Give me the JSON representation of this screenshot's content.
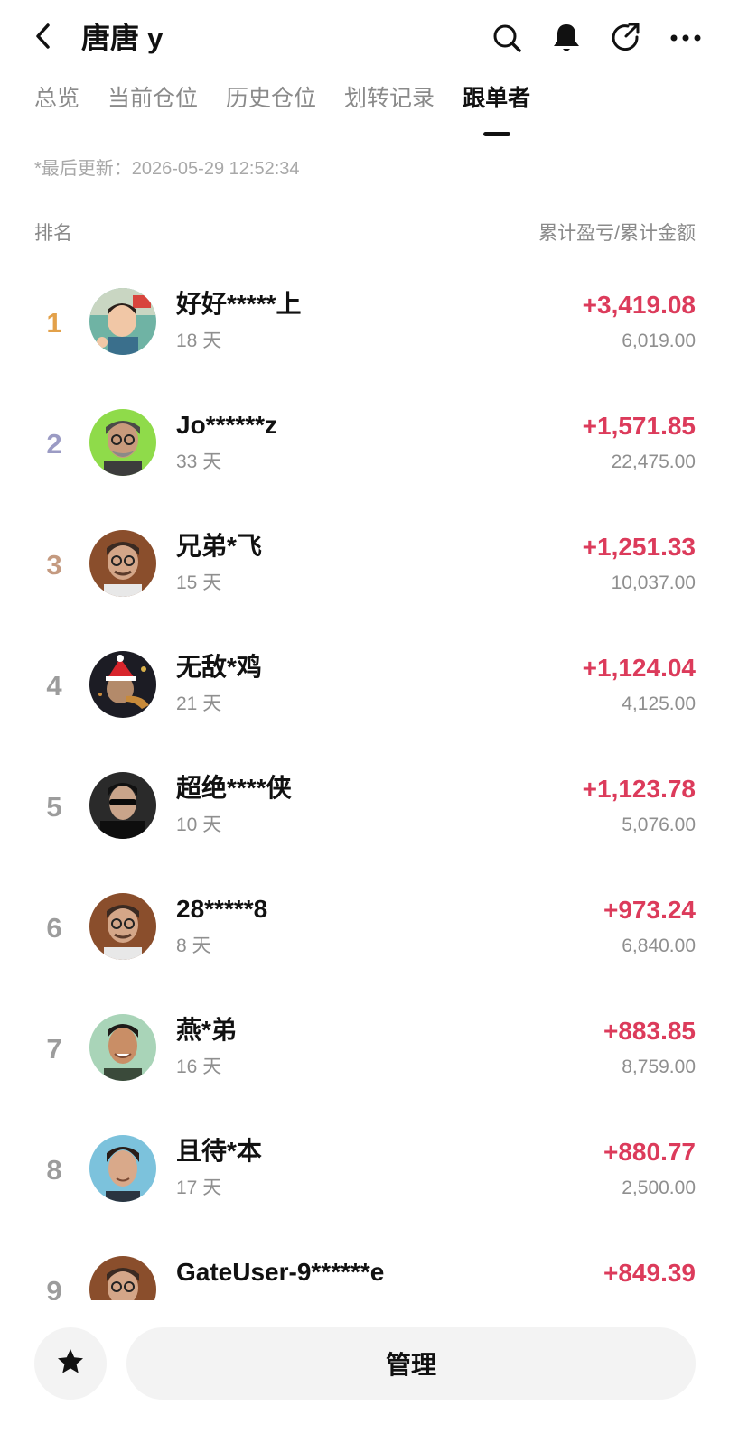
{
  "header": {
    "title": "唐唐 y",
    "icons": [
      "back-icon",
      "search-icon",
      "bell-icon",
      "share-icon",
      "more-icon"
    ]
  },
  "tabs": [
    {
      "label": "总览",
      "active": false
    },
    {
      "label": "当前仓位",
      "active": false
    },
    {
      "label": "历史仓位",
      "active": false
    },
    {
      "label": "划转记录",
      "active": false
    },
    {
      "label": "跟单者",
      "active": true
    }
  ],
  "last_updated": "*最后更新：2026-05-29 12:52:34",
  "columns": {
    "left": "排名",
    "right": "累计盈亏/累计金额"
  },
  "followers": [
    {
      "rank": "1",
      "name": "好好*****上",
      "days": "18 天",
      "pnl": "+3,419.08",
      "amount": "6,019.00"
    },
    {
      "rank": "2",
      "name": "Jo******z",
      "days": "33 天",
      "pnl": "+1,571.85",
      "amount": "22,475.00"
    },
    {
      "rank": "3",
      "name": "兄弟*飞",
      "days": "15 天",
      "pnl": "+1,251.33",
      "amount": "10,037.00"
    },
    {
      "rank": "4",
      "name": "无敌*鸡",
      "days": "21 天",
      "pnl": "+1,124.04",
      "amount": "4,125.00"
    },
    {
      "rank": "5",
      "name": "超绝****侠",
      "days": "10 天",
      "pnl": "+1,123.78",
      "amount": "5,076.00"
    },
    {
      "rank": "6",
      "name": "28*****8",
      "days": "8 天",
      "pnl": "+973.24",
      "amount": "6,840.00"
    },
    {
      "rank": "7",
      "name": "燕*弟",
      "days": "16 天",
      "pnl": "+883.85",
      "amount": "8,759.00"
    },
    {
      "rank": "8",
      "name": "且待*本",
      "days": "17 天",
      "pnl": "+880.77",
      "amount": "2,500.00"
    },
    {
      "rank": "9",
      "name": "GateUser-9******e",
      "days": "",
      "pnl": "+849.39",
      "amount": ""
    }
  ],
  "colors": {
    "positive": "#dc3b5b",
    "rank_gold": "#e3a14a",
    "rank_silver": "#9b9bc4",
    "rank_bronze": "#c49a80",
    "rank_default": "#9c9c9c"
  },
  "bottom": {
    "manage_label": "管理",
    "icons": [
      "star-icon"
    ]
  }
}
